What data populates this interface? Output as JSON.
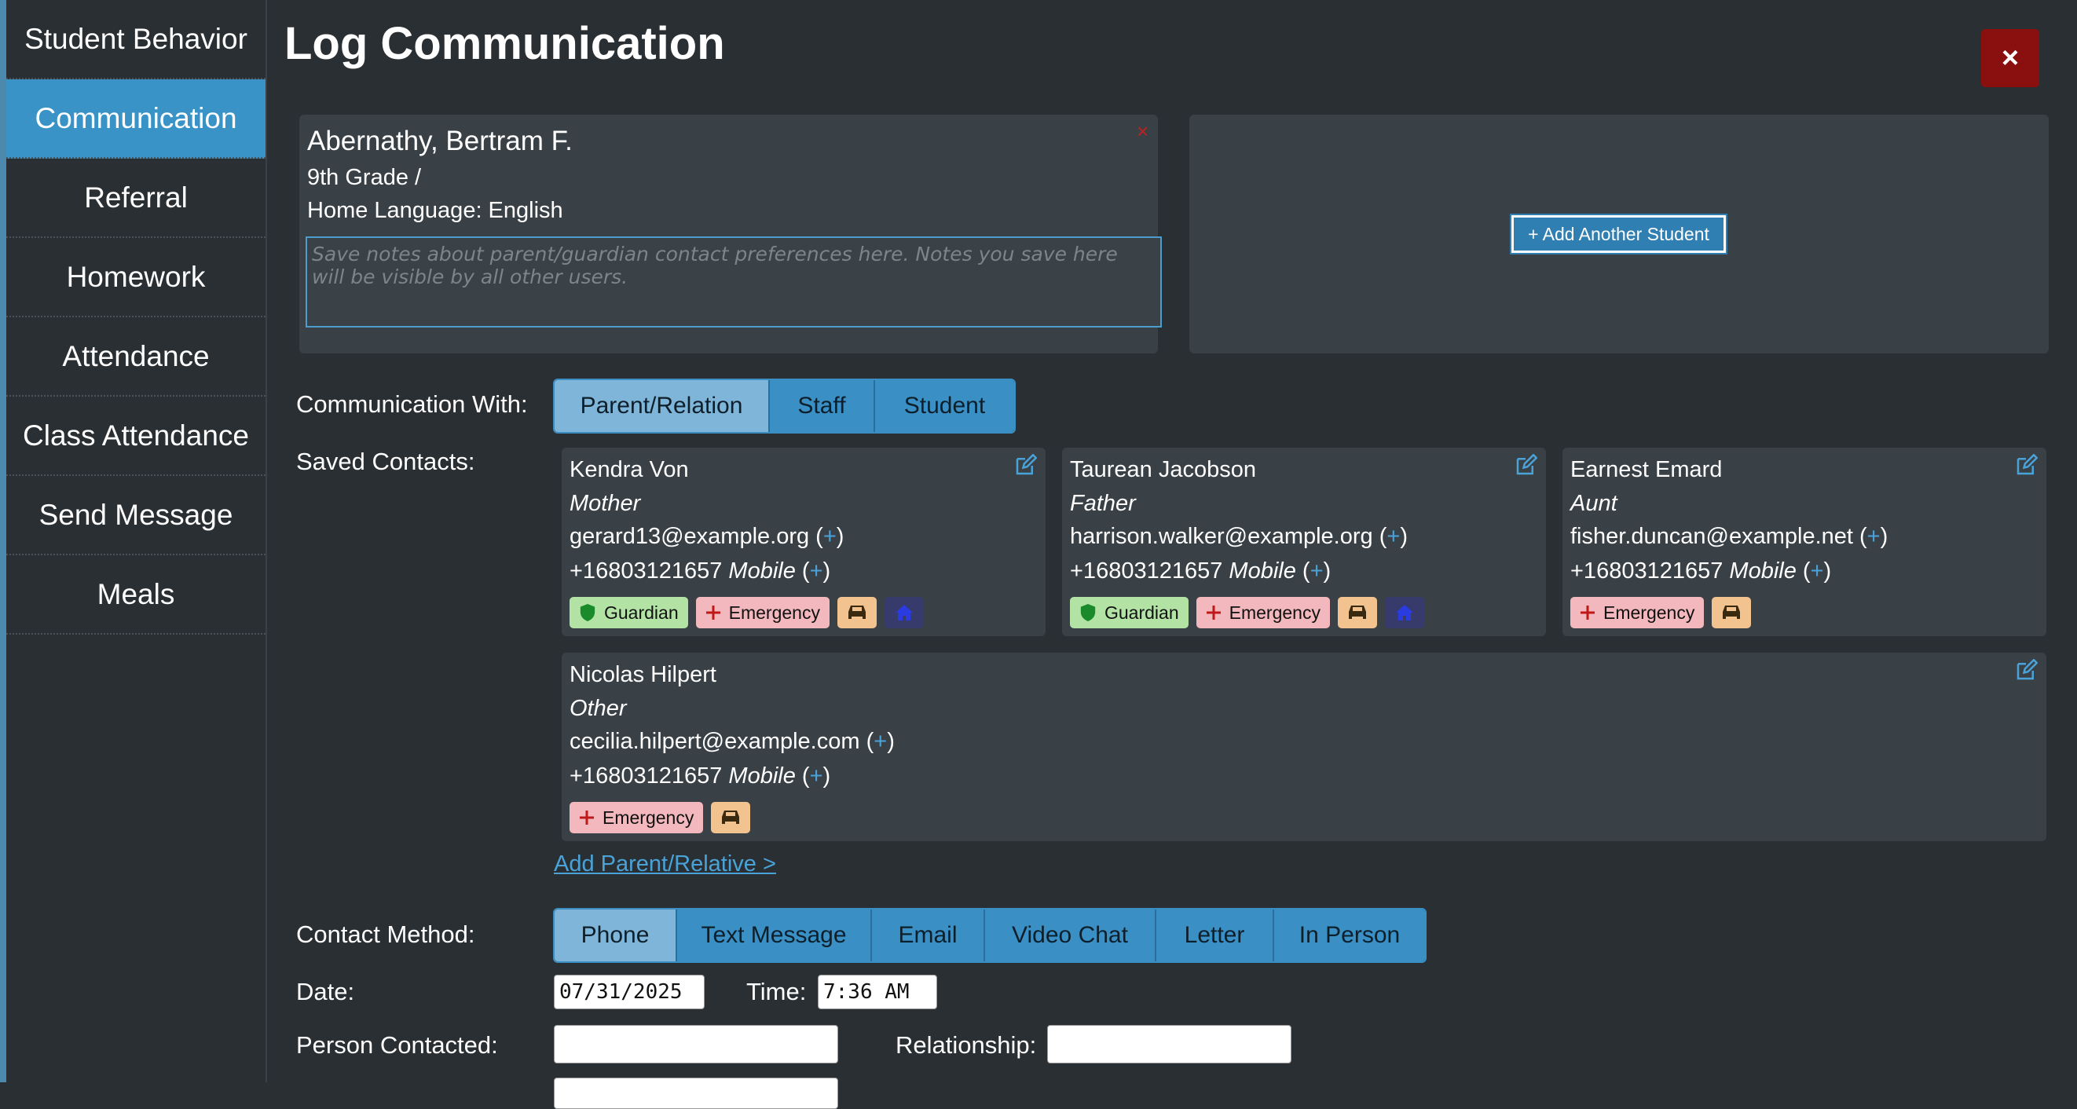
{
  "sidebar": {
    "items": [
      {
        "label": "Student Behavior",
        "active": false
      },
      {
        "label": "Communication",
        "active": true
      },
      {
        "label": "Referral",
        "active": false
      },
      {
        "label": "Homework",
        "active": false
      },
      {
        "label": "Attendance",
        "active": false
      },
      {
        "label": "Class Attendance",
        "active": false
      },
      {
        "label": "Send Message",
        "active": false
      },
      {
        "label": "Meals",
        "active": false
      }
    ]
  },
  "header": {
    "title": "Log Communication",
    "close_label": "×"
  },
  "student": {
    "name": "Abernathy, Bertram F.",
    "grade": "9th Grade /",
    "home_language": "Home Language: English",
    "remove_label": "×",
    "notes_placeholder": "Save notes about parent/guardian contact preferences here. Notes you save here will be visible by all other users.",
    "add_another_label": "+ Add Another Student"
  },
  "communication_with": {
    "label": "Communication With:",
    "options": [
      "Parent/Relation",
      "Staff",
      "Student"
    ],
    "selected": "Parent/Relation"
  },
  "saved_contacts": {
    "label": "Saved Contacts:",
    "contacts": [
      {
        "name": "Kendra Von",
        "relation": "Mother",
        "email": "gerard13@example.org",
        "phone": "+16803121657",
        "phone_type": "Mobile",
        "guardian": "Guardian",
        "emergency": "Emergency"
      },
      {
        "name": "Taurean Jacobson",
        "relation": "Father",
        "email": "harrison.walker@example.org",
        "phone": "+16803121657",
        "phone_type": "Mobile",
        "guardian": "Guardian",
        "emergency": "Emergency"
      },
      {
        "name": "Earnest Emard",
        "relation": "Aunt",
        "email": "fisher.duncan@example.net",
        "phone": "+16803121657",
        "phone_type": "Mobile",
        "emergency": "Emergency"
      },
      {
        "name": "Nicolas Hilpert",
        "relation": "Other",
        "email": "cecilia.hilpert@example.com",
        "phone": "+16803121657",
        "phone_type": "Mobile",
        "emergency": "Emergency"
      }
    ],
    "add_link": "Add Parent/Relative >"
  },
  "contact_method": {
    "label": "Contact Method:",
    "options": [
      "Phone",
      "Text Message",
      "Email",
      "Video Chat",
      "Letter",
      "In Person"
    ],
    "selected": "Phone"
  },
  "form": {
    "date_label": "Date:",
    "date_value": "07/31/2025",
    "time_label": "Time:",
    "time_value": "7:36 AM",
    "person_label": "Person Contacted:",
    "person_value": "",
    "relationship_label": "Relationship:",
    "relationship_value": ""
  },
  "icons": {
    "edit": "edit-icon",
    "guardian": "shield-icon",
    "emergency": "plus-icon",
    "pickup": "car-icon",
    "home": "home-icon"
  },
  "colors": {
    "accent": "#3a93c6",
    "close": "#8a1010",
    "guardian_badge": "#b2e3a5",
    "emergency_badge": "#f2b8bd",
    "pickup_badge": "#f3c38f",
    "home_badge": "#363b6b"
  }
}
